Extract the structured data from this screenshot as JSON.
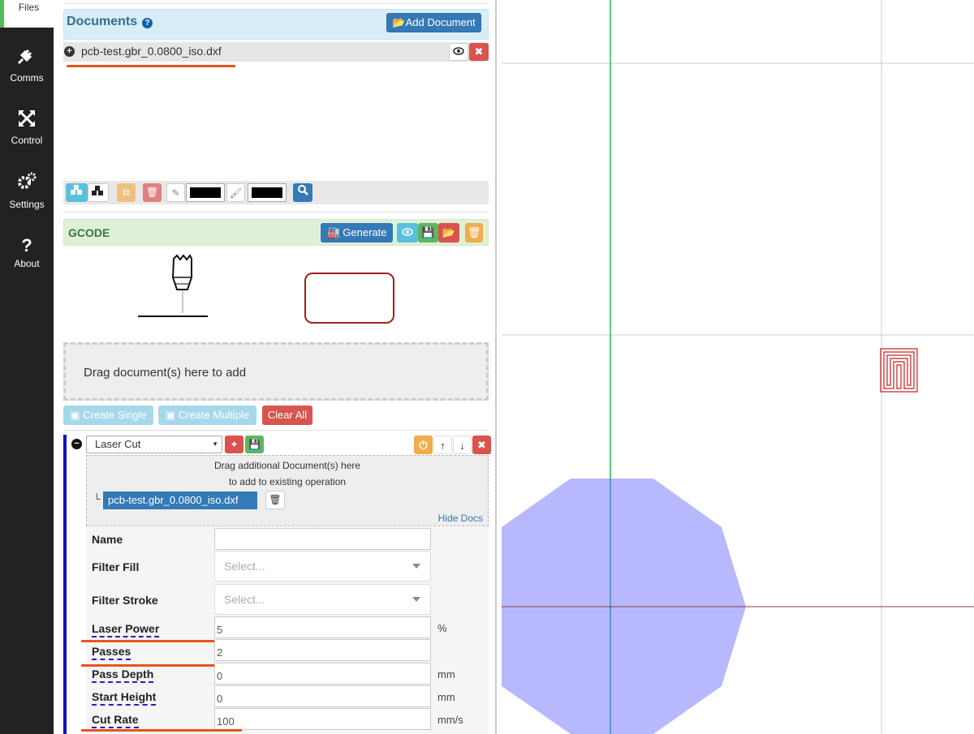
{
  "sidebar": {
    "items": [
      {
        "label": "Files",
        "icon": "files-icon"
      },
      {
        "label": "Comms",
        "icon": "plug-icon"
      },
      {
        "label": "Control",
        "icon": "arrows-icon"
      },
      {
        "label": "Settings",
        "icon": "gears-icon"
      },
      {
        "label": "About",
        "icon": "question-icon"
      }
    ]
  },
  "documents": {
    "title": "Documents",
    "add_label": "Add Document",
    "items": [
      {
        "name": "pcb-test.gbr_0.0800_iso.dxf"
      }
    ]
  },
  "gcode": {
    "title": "GCODE",
    "generate_label": "Generate"
  },
  "dropzone": {
    "text": "Drag document(s) here to add"
  },
  "create": {
    "single_label": "Create Single",
    "multiple_label": "Create Multiple",
    "clear_label": "Clear All"
  },
  "operation": {
    "type": "Laser Cut",
    "drop_line1": "Drag additional Document(s) here",
    "drop_line2": "to add to existing operation",
    "doc_name": "pcb-test.gbr_0.0800_iso.dxf",
    "hide_docs": "Hide Docs",
    "fields": {
      "name": {
        "label": "Name",
        "value": ""
      },
      "filter_fill": {
        "label": "Filter Fill",
        "placeholder": "Select..."
      },
      "filter_stroke": {
        "label": "Filter Stroke",
        "placeholder": "Select..."
      },
      "laser_power": {
        "label": "Laser Power",
        "value": "5",
        "unit": "%"
      },
      "passes": {
        "label": "Passes",
        "value": "2"
      },
      "pass_depth": {
        "label": "Pass Depth",
        "value": "0",
        "unit": "mm"
      },
      "start_height": {
        "label": "Start Height",
        "value": "0",
        "unit": "mm"
      },
      "cut_rate": {
        "label": "Cut Rate",
        "value": "100",
        "unit": "mm/s"
      }
    }
  },
  "colors": {
    "accent_blue": "#337ab7",
    "danger": "#d9534f",
    "success": "#5cb85c",
    "warning": "#f0ad4e",
    "info": "#5bc0de",
    "op_border": "#1010c0",
    "annotation": "#e8541c",
    "shape_fill": "#b8b8ff",
    "y_axis": "#3cb043",
    "x_axis": "#8b3a3a"
  }
}
